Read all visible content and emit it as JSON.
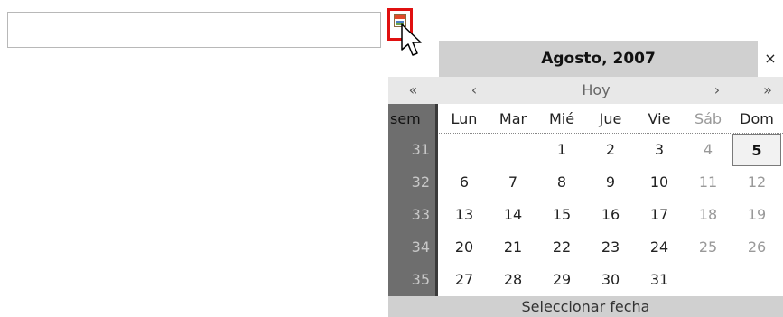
{
  "input": {
    "value": ""
  },
  "calendar": {
    "title": "Agosto, 2007",
    "close": "×",
    "nav": {
      "prev_year": "«",
      "prev_month": "‹",
      "today": "Hoy",
      "next_month": "›",
      "next_year": "»"
    },
    "week_header": "sem",
    "day_headers": [
      "Lun",
      "Mar",
      "Mié",
      "Jue",
      "Vie",
      "Sáb",
      "Dom"
    ],
    "weeks": [
      {
        "week": "31",
        "days": [
          "",
          "",
          "1",
          "2",
          "3",
          "4",
          "5"
        ]
      },
      {
        "week": "32",
        "days": [
          "6",
          "7",
          "8",
          "9",
          "10",
          "11",
          "12"
        ]
      },
      {
        "week": "33",
        "days": [
          "13",
          "14",
          "15",
          "16",
          "17",
          "18",
          "19"
        ]
      },
      {
        "week": "34",
        "days": [
          "20",
          "21",
          "22",
          "23",
          "24",
          "25",
          "26"
        ]
      },
      {
        "week": "35",
        "days": [
          "27",
          "28",
          "29",
          "30",
          "31",
          "",
          ""
        ]
      }
    ],
    "selected_day": "5",
    "footer": "Seleccionar fecha"
  },
  "icons": {
    "trigger": "calendar-icon",
    "cursor": "mouse-pointer-icon"
  },
  "colors": {
    "trigger_border": "#e01010",
    "header_bg": "#d0d0d0",
    "week_col_bg": "#6e6e6e"
  }
}
